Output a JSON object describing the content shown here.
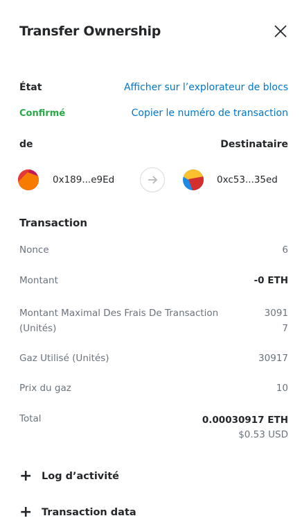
{
  "header": {
    "title": "Transfer Ownership"
  },
  "status": {
    "label": "État",
    "value": "Confirmé",
    "explorer_link": "Afficher sur l’explorateur de blocs",
    "copy_tx_link": "Copier le numéro de transaction",
    "status_color": "#28a745"
  },
  "parties": {
    "from_label": "de",
    "to_label": "Destinataire",
    "from_address": "0x189...e9Ed",
    "to_address": "0xc53...35ed"
  },
  "transaction": {
    "title": "Transaction",
    "nonce": {
      "label": "Nonce",
      "value": "6"
    },
    "amount": {
      "label": "Montant",
      "value": "-0 ETH"
    },
    "max_fee": {
      "label_line1": "Montant Maximal Des Frais De Transaction",
      "label_line2": "(Unités)",
      "value_line1": "3091",
      "value_line2": "7"
    },
    "gas_used": {
      "label": "Gaz Utilisé (Unités)",
      "value": "30917"
    },
    "gas_price": {
      "label": "Prix du gaz",
      "value": "10"
    },
    "total": {
      "label": "Total",
      "eth": "0.00030917 ETH",
      "usd": "$0.53 USD"
    }
  },
  "expanders": {
    "activity_log": "Log d’activité",
    "transaction_data": "Transaction data"
  },
  "colors": {
    "link": "#0376c9",
    "text": "#24272a",
    "muted": "#6a737d"
  },
  "icons": {
    "close": "close-icon",
    "arrow": "arrow-right-icon",
    "plus": "plus-icon"
  }
}
